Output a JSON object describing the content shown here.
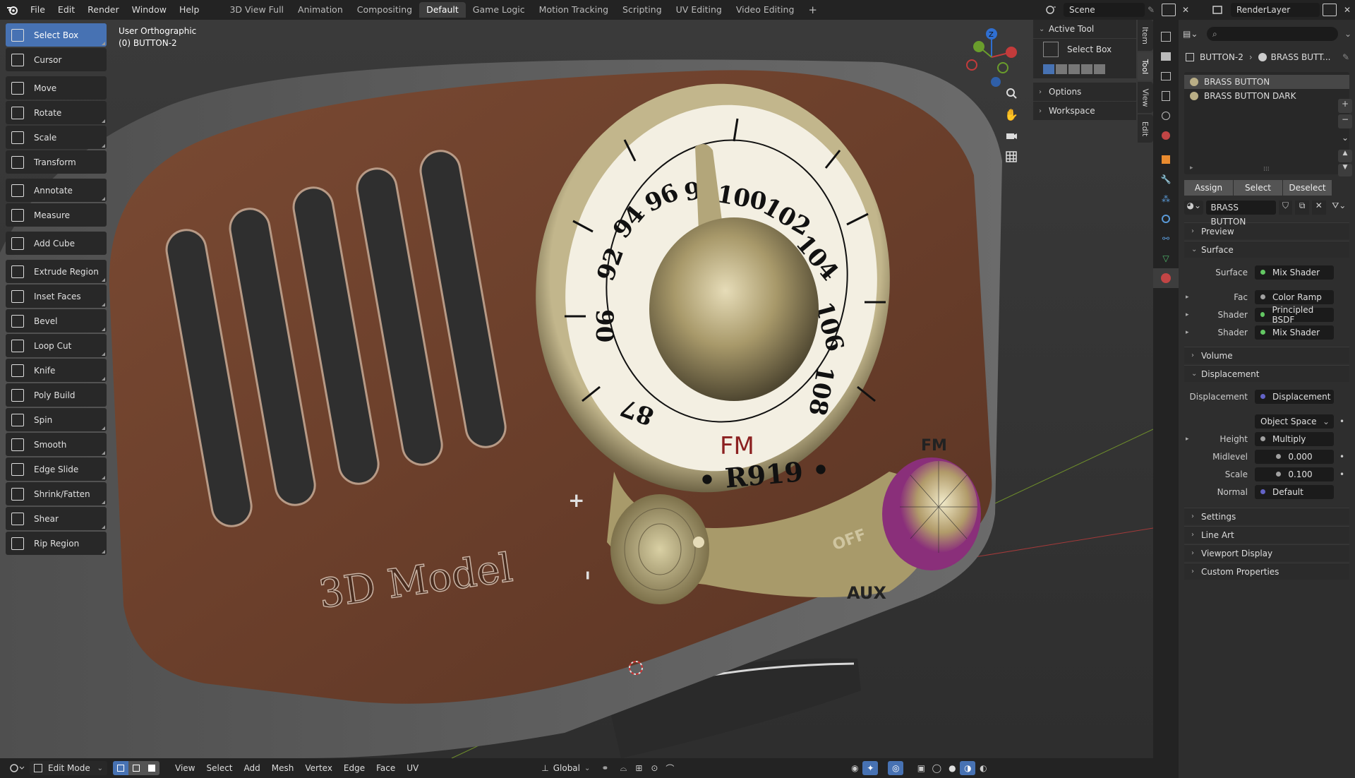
{
  "topbar": {
    "menus": [
      "File",
      "Edit",
      "Render",
      "Window",
      "Help"
    ],
    "workspaces": [
      "3D View Full",
      "Animation",
      "Compositing",
      "Default",
      "Game Logic",
      "Motion Tracking",
      "Scripting",
      "UV Editing",
      "Video Editing"
    ],
    "active_workspace": "Default",
    "scene": "Scene",
    "view_layer": "RenderLayer"
  },
  "viewport": {
    "view_name": "User Orthographic",
    "object_name": "(0) BUTTON-2"
  },
  "toolbar": {
    "tools": [
      {
        "label": "Select Box",
        "icon": "select-box-icon",
        "active": true
      },
      {
        "label": "Cursor",
        "icon": "cursor-icon"
      },
      {
        "label": "Move",
        "icon": "move-icon"
      },
      {
        "label": "Rotate",
        "icon": "rotate-icon"
      },
      {
        "label": "Scale",
        "icon": "scale-icon"
      },
      {
        "label": "Transform",
        "icon": "transform-icon"
      },
      {
        "label": "Annotate",
        "icon": "annotate-icon"
      },
      {
        "label": "Measure",
        "icon": "measure-icon"
      },
      {
        "label": "Add Cube",
        "icon": "add-cube-icon"
      },
      {
        "label": "Extrude Region",
        "icon": "extrude-region-icon"
      },
      {
        "label": "Inset Faces",
        "icon": "inset-faces-icon"
      },
      {
        "label": "Bevel",
        "icon": "bevel-icon"
      },
      {
        "label": "Loop Cut",
        "icon": "loop-cut-icon"
      },
      {
        "label": "Knife",
        "icon": "knife-icon"
      },
      {
        "label": "Poly Build",
        "icon": "poly-build-icon"
      },
      {
        "label": "Spin",
        "icon": "spin-icon"
      },
      {
        "label": "Smooth",
        "icon": "smooth-icon"
      },
      {
        "label": "Edge Slide",
        "icon": "edge-slide-icon"
      },
      {
        "label": "Shrink/Fatten",
        "icon": "shrink-fatten-icon"
      },
      {
        "label": "Shear",
        "icon": "shear-icon"
      },
      {
        "label": "Rip Region",
        "icon": "rip-region-icon"
      }
    ]
  },
  "tool_panel": {
    "active_tool_header": "Active Tool",
    "active_tool_name": "Select Box",
    "options": "Options",
    "workspace": "Workspace"
  },
  "side_tabs": [
    "Item",
    "Tool",
    "View",
    "Edit"
  ],
  "model": {
    "text": "3D Model",
    "dial_numbers": [
      "87",
      "90",
      "92",
      "94",
      "96",
      "9",
      "100",
      "102",
      "104",
      "106",
      "108"
    ],
    "dial_band": "FM",
    "dial_brand": "• R919 •",
    "knob_labels": {
      "fm": "FM",
      "off": "OFF",
      "aux": "AUX",
      "plus": "+",
      "minus": "–"
    }
  },
  "bottombar": {
    "mode": "Edit Mode",
    "menus": [
      "View",
      "Select",
      "Add",
      "Mesh",
      "Vertex",
      "Edge",
      "Face",
      "UV"
    ],
    "orientation": "Global"
  },
  "properties": {
    "breadcrumb_object": "BUTTON-2",
    "breadcrumb_material": "BRASS BUTT...",
    "slots": [
      "BRASS BUTTON",
      "BRASS BUTTON DARK"
    ],
    "slot_buttons": [
      "Assign",
      "Select",
      "Deselect"
    ],
    "material_name": "BRASS BUTTON",
    "sections": {
      "preview": "Preview",
      "surface": "Surface",
      "volume": "Volume",
      "displacement": "Displacement",
      "settings": "Settings",
      "line_art": "Line Art",
      "viewport_display": "Viewport Display",
      "custom_properties": "Custom Properties"
    },
    "surface_rows": [
      {
        "label": "Surface",
        "value": "Mix Shader",
        "color": "#63c763"
      },
      {
        "label": "Fac",
        "value": "Color Ramp",
        "color": "#a1a1a1"
      },
      {
        "label": "Shader",
        "value": "Principled BSDF",
        "color": "#63c763"
      },
      {
        "label": "Shader",
        "value": "Mix Shader",
        "color": "#63c763"
      }
    ],
    "displacement_rows": [
      {
        "label": "Displacement",
        "value": "Displacement",
        "color": "#6363c7"
      },
      {
        "label": "",
        "value": "Object Space",
        "color": ""
      },
      {
        "label": "Height",
        "value": "Multiply",
        "color": "#a1a1a1"
      },
      {
        "label": "Midlevel",
        "value": "0.000",
        "color": "#a1a1a1"
      },
      {
        "label": "Scale",
        "value": "0.100",
        "color": "#a1a1a1"
      },
      {
        "label": "Normal",
        "value": "Default",
        "color": "#6363c7"
      }
    ]
  }
}
